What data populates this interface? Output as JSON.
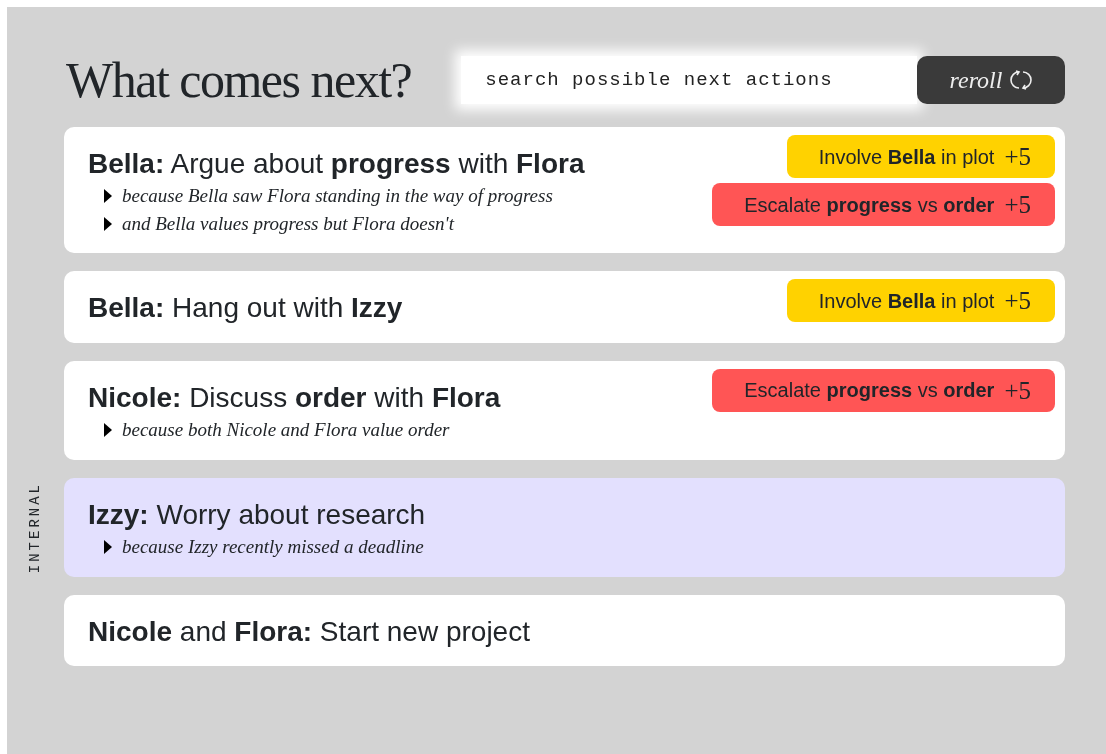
{
  "header": {
    "title": "What comes next?",
    "search": {
      "placeholder": "search possible next actions"
    },
    "reroll_button": "reroll"
  },
  "actions": [
    {
      "kind": "normal",
      "title": "**Bella:** Argue about **progress** with **Flora**",
      "reasons": [
        "because Bella saw Flora standing in the way of progress",
        "and Bella values progress but Flora doesn't"
      ],
      "tags": [
        {
          "label": "Involve **Bella** in plot",
          "points": "+5",
          "color": "#ffd200"
        },
        {
          "label": "Escalate **progress** vs **order**",
          "points": "+5",
          "color": "#ff5555"
        }
      ]
    },
    {
      "kind": "normal",
      "title": "**Bella:** Hang out with **Izzy**",
      "tags": [
        {
          "label": "Involve **Bella** in plot",
          "points": "+5",
          "color": "#ffd200"
        }
      ]
    },
    {
      "kind": "normal",
      "title": "**Nicole:** Discuss **order** with **Flora**",
      "reasons": [
        "because both Nicole and Flora value order"
      ],
      "tags": [
        {
          "label": "Escalate **progress** vs **order**",
          "points": "+5",
          "color": "#ff5555"
        }
      ]
    },
    {
      "kind": "internal",
      "side_label": "INTERNAL",
      "title": "**Izzy:** Worry about research",
      "reasons": [
        "because Izzy recently missed a deadline"
      ]
    },
    {
      "kind": "normal",
      "title": "**Nicole** and **Flora:** Start new project"
    }
  ]
}
